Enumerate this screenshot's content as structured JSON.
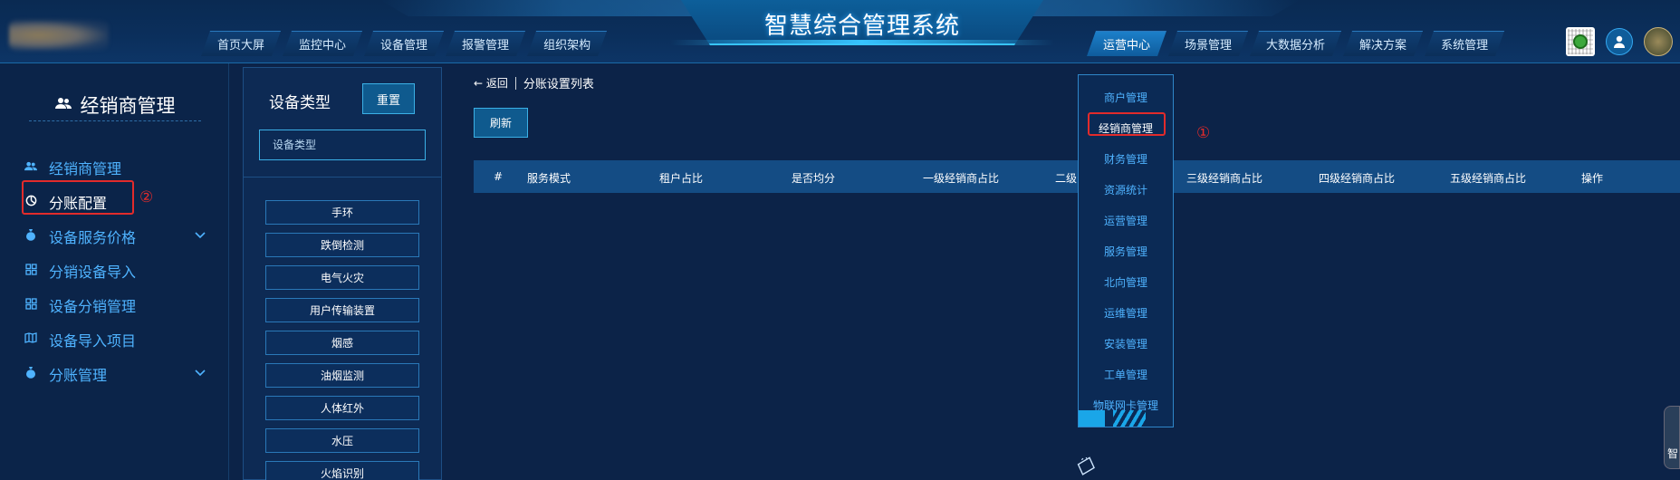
{
  "header": {
    "title": "智慧综合管理系统",
    "nav_left": [
      "首页大屏",
      "监控中心",
      "设备管理",
      "报警管理",
      "组织架构"
    ],
    "nav_right": [
      "运营中心",
      "场景管理",
      "大数据分析",
      "解决方案",
      "系统管理"
    ],
    "active_nav": "运营中心",
    "icons": [
      "qr-code-icon",
      "user-icon",
      "avatar"
    ]
  },
  "sidebar": {
    "heading": "经销商管理",
    "heading_icon": "users-icon",
    "items": [
      {
        "label": "经销商管理",
        "icon": "users-icon",
        "active": false
      },
      {
        "label": "分账配置",
        "icon": "pie-chart-icon",
        "active": true
      },
      {
        "label": "设备服务价格",
        "icon": "money-bag-icon",
        "has_children": true
      },
      {
        "label": "分销设备导入",
        "icon": "grid-icon",
        "active": false
      },
      {
        "label": "设备分销管理",
        "icon": "grid-icon",
        "active": false
      },
      {
        "label": "设备导入项目",
        "icon": "map-icon",
        "active": false
      },
      {
        "label": "分账管理",
        "icon": "money-bag-icon",
        "has_children": true
      }
    ],
    "annotation": "②"
  },
  "filter": {
    "title": "设备类型",
    "reset_label": "重置",
    "input_placeholder": "设备类型",
    "types": [
      "手环",
      "跌倒检测",
      "电气火灾",
      "用户传输装置",
      "烟感",
      "油烟监测",
      "人体红外",
      "水压",
      "火焰识别"
    ]
  },
  "main": {
    "back_label": "← 返回",
    "page_title": "分账设置列表",
    "refresh_label": "刷新",
    "columns": [
      "#",
      "服务模式",
      "租户占比",
      "是否均分",
      "一级经销商占比",
      "二级",
      "三级经销商占比",
      "四级经销商占比",
      "五级经销商占比",
      "操作"
    ]
  },
  "dropdown": {
    "items": [
      "商户管理",
      "经销商管理",
      "财务管理",
      "资源统计",
      "运营管理",
      "服务管理",
      "北向管理",
      "运维管理",
      "安装管理",
      "工单管理",
      "物联网卡管理"
    ],
    "active": "经销商管理",
    "annotation": "①"
  },
  "right_edge_label": "智",
  "colors": {
    "background": "#0c2348",
    "accent": "#3bb0e6",
    "link_blue": "#4fb3ff",
    "annotation_red": "#e22b2b"
  }
}
